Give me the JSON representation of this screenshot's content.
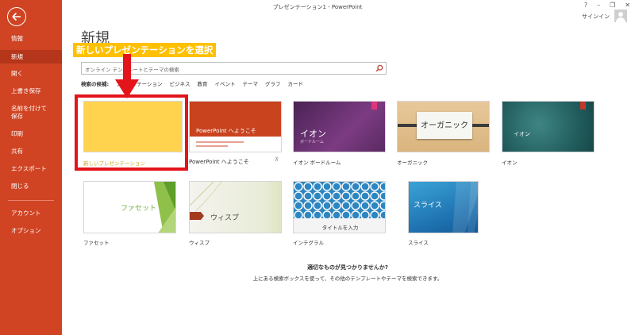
{
  "window": {
    "title": "プレゼンテーション1 - PowerPoint",
    "controls": [
      "?",
      "–",
      "❐",
      "✕"
    ],
    "signin": "サインイン"
  },
  "sidebar": {
    "items": [
      {
        "label": "情報"
      },
      {
        "label": "新規",
        "active": true
      },
      {
        "label": "開く"
      },
      {
        "label": "上書き保存"
      },
      {
        "label": "名前を付けて"
      },
      {
        "label": "保存"
      },
      {
        "label": "印刷"
      },
      {
        "label": "共有"
      },
      {
        "label": "エクスポート"
      },
      {
        "label": "閉じる"
      },
      {
        "label": "アカウント"
      },
      {
        "label": "オプション"
      }
    ]
  },
  "page": {
    "title": "新規",
    "annotation": "新しいプレゼンテーションを選択",
    "search_placeholder": "オンライン テンプレートとテーマの検索",
    "suggest_label": "検索の候補:",
    "suggestions": [
      "プレゼンテーション",
      "ビジネス",
      "教育",
      "イベント",
      "テーマ",
      "グラフ",
      "カード"
    ]
  },
  "templates": [
    {
      "label": "新しいプレゼンテーション",
      "thumb_text": ""
    },
    {
      "label": "PowerPoint へようこそ",
      "thumb_text": "PowerPoint へようこそ"
    },
    {
      "label": "イオン ボードルーム",
      "thumb_text": "イオン",
      "thumb_sub": "ボードルーム"
    },
    {
      "label": "オーガニック",
      "thumb_text": "オーガニック"
    },
    {
      "label": "イオン",
      "thumb_text": "イオン"
    },
    {
      "label": "ファセット",
      "thumb_text": "ファセット"
    },
    {
      "label": "ウィスプ",
      "thumb_text": "ウィスプ"
    },
    {
      "label": "インテグラル",
      "thumb_text": "タイトルを入力"
    },
    {
      "label": "スライス",
      "thumb_text": "スライス"
    }
  ],
  "footer": {
    "heading": "適切なものが見つかりませんか?",
    "text": "上にある検索ボックスを使って、その他のテンプレートやテーマを検索できます。"
  },
  "colors": {
    "sidebar": "#d04423",
    "annotation_bg": "#ffc000",
    "highlight": "#e3151b"
  }
}
